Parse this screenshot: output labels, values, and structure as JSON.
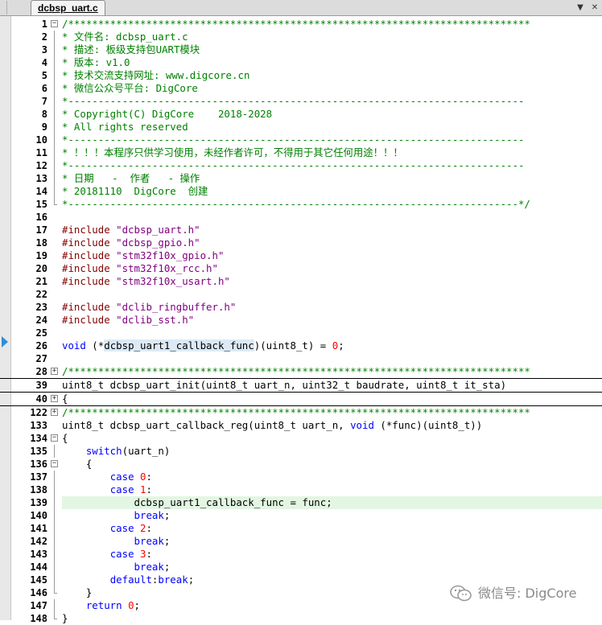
{
  "tab": {
    "title": "dcbsp_uart.c",
    "dropdown_icon": "chevron-down-icon",
    "close_icon": "close-icon"
  },
  "watermark": {
    "text": "微信号: DigCore",
    "icon": "wechat-icon"
  },
  "lines": [
    {
      "n": "1",
      "fold": "box-minus",
      "segs": [
        {
          "t": "/*****************************************************************************",
          "c": "comment"
        }
      ]
    },
    {
      "n": "2",
      "fold": "line",
      "segs": [
        {
          "t": "* 文件名: dcbsp_uart.c",
          "c": "comment"
        }
      ]
    },
    {
      "n": "3",
      "fold": "line",
      "segs": [
        {
          "t": "* 描述: 板级支持包UART模块",
          "c": "comment"
        }
      ]
    },
    {
      "n": "4",
      "fold": "line",
      "segs": [
        {
          "t": "* 版本: v1.0",
          "c": "comment"
        }
      ]
    },
    {
      "n": "5",
      "fold": "line",
      "segs": [
        {
          "t": "* 技术交流支持网址: www.digcore.cn",
          "c": "comment"
        }
      ]
    },
    {
      "n": "6",
      "fold": "line",
      "segs": [
        {
          "t": "* 微信公众号平台: DigCore",
          "c": "comment"
        }
      ]
    },
    {
      "n": "7",
      "fold": "line",
      "segs": [
        {
          "t": "*----------------------------------------------------------------------------",
          "c": "comment"
        }
      ]
    },
    {
      "n": "8",
      "fold": "line",
      "segs": [
        {
          "t": "* Copyright(C) DigCore    2018-2028",
          "c": "comment"
        }
      ]
    },
    {
      "n": "9",
      "fold": "line",
      "segs": [
        {
          "t": "* All rights reserved",
          "c": "comment"
        }
      ]
    },
    {
      "n": "10",
      "fold": "line",
      "segs": [
        {
          "t": "*----------------------------------------------------------------------------",
          "c": "comment"
        }
      ]
    },
    {
      "n": "11",
      "fold": "line",
      "segs": [
        {
          "t": "* ！！！本程序只供学习使用，未经作者许可，不得用于其它任何用途！！！",
          "c": "comment"
        }
      ]
    },
    {
      "n": "12",
      "fold": "line",
      "segs": [
        {
          "t": "*----------------------------------------------------------------------------",
          "c": "comment"
        }
      ]
    },
    {
      "n": "13",
      "fold": "line",
      "segs": [
        {
          "t": "* 日期   -  作者   - 操作",
          "c": "comment"
        }
      ]
    },
    {
      "n": "14",
      "fold": "line",
      "segs": [
        {
          "t": "* 20181110  DigCore  创建",
          "c": "comment"
        }
      ]
    },
    {
      "n": "15",
      "fold": "end",
      "segs": [
        {
          "t": "*---------------------------------------------------------------------------*/",
          "c": "comment"
        }
      ]
    },
    {
      "n": "16",
      "fold": "none",
      "segs": []
    },
    {
      "n": "17",
      "fold": "none",
      "segs": [
        {
          "t": "#include ",
          "c": "pp"
        },
        {
          "t": "\"dcbsp_uart.h\"",
          "c": "str"
        }
      ]
    },
    {
      "n": "18",
      "fold": "none",
      "segs": [
        {
          "t": "#include ",
          "c": "pp"
        },
        {
          "t": "\"dcbsp_gpio.h\"",
          "c": "str"
        }
      ]
    },
    {
      "n": "19",
      "fold": "none",
      "segs": [
        {
          "t": "#include ",
          "c": "pp"
        },
        {
          "t": "\"stm32f10x_gpio.h\"",
          "c": "str"
        }
      ]
    },
    {
      "n": "20",
      "fold": "none",
      "segs": [
        {
          "t": "#include ",
          "c": "pp"
        },
        {
          "t": "\"stm32f10x_rcc.h\"",
          "c": "str"
        }
      ]
    },
    {
      "n": "21",
      "fold": "none",
      "segs": [
        {
          "t": "#include ",
          "c": "pp"
        },
        {
          "t": "\"stm32f10x_usart.h\"",
          "c": "str"
        }
      ]
    },
    {
      "n": "22",
      "fold": "none",
      "segs": []
    },
    {
      "n": "23",
      "fold": "none",
      "segs": [
        {
          "t": "#include ",
          "c": "pp"
        },
        {
          "t": "\"dclib_ringbuffer.h\"",
          "c": "str"
        }
      ]
    },
    {
      "n": "24",
      "fold": "none",
      "segs": [
        {
          "t": "#include ",
          "c": "pp"
        },
        {
          "t": "\"dclib_sst.h\"",
          "c": "str"
        }
      ]
    },
    {
      "n": "25",
      "fold": "none",
      "segs": []
    },
    {
      "n": "26",
      "fold": "none",
      "segs": [
        {
          "t": "void",
          "c": "kw"
        },
        {
          "t": " (*",
          "c": "id"
        },
        {
          "t": "dcbsp_uart1_callback_func",
          "c": "idhl"
        },
        {
          "t": ")(uint8_t) = ",
          "c": "id"
        },
        {
          "t": "0",
          "c": "num"
        },
        {
          "t": ";",
          "c": "id"
        }
      ]
    },
    {
      "n": "27",
      "fold": "none",
      "segs": []
    },
    {
      "n": "28",
      "fold": "box-plus",
      "sep": true,
      "segs": [
        {
          "t": "/*****************************************************************************",
          "c": "comment"
        }
      ]
    },
    {
      "n": "39",
      "fold": "none",
      "sep": true,
      "segs": [
        {
          "t": "uint8_t dcbsp_uart_init(uint8_t uart_n, uint32_t baudrate, uint8_t it_sta)",
          "c": "id"
        }
      ]
    },
    {
      "n": "40",
      "fold": "box-plus",
      "sep": true,
      "segs": [
        {
          "t": "{",
          "c": "id"
        }
      ]
    },
    {
      "n": "122",
      "fold": "box-plus",
      "segs": [
        {
          "t": "/*****************************************************************************",
          "c": "comment"
        }
      ]
    },
    {
      "n": "133",
      "fold": "none",
      "segs": [
        {
          "t": "uint8_t dcbsp_uart_callback_reg(uint8_t uart_n, ",
          "c": "id"
        },
        {
          "t": "void",
          "c": "kw"
        },
        {
          "t": " (*func)(uint8_t))",
          "c": "id"
        }
      ]
    },
    {
      "n": "134",
      "fold": "box-minus",
      "segs": [
        {
          "t": "{",
          "c": "id"
        }
      ]
    },
    {
      "n": "135",
      "fold": "line",
      "segs": [
        {
          "t": "    ",
          "c": "id"
        },
        {
          "t": "switch",
          "c": "kw"
        },
        {
          "t": "(uart_n)",
          "c": "id"
        }
      ]
    },
    {
      "n": "136",
      "fold": "box-minus",
      "segs": [
        {
          "t": "    {",
          "c": "id"
        }
      ]
    },
    {
      "n": "137",
      "fold": "line",
      "segs": [
        {
          "t": "        ",
          "c": "id"
        },
        {
          "t": "case",
          "c": "kw"
        },
        {
          "t": " ",
          "c": "id"
        },
        {
          "t": "0",
          "c": "num"
        },
        {
          "t": ":",
          "c": "id"
        }
      ]
    },
    {
      "n": "138",
      "fold": "line",
      "segs": [
        {
          "t": "        ",
          "c": "id"
        },
        {
          "t": "case",
          "c": "kw"
        },
        {
          "t": " ",
          "c": "id"
        },
        {
          "t": "1",
          "c": "num"
        },
        {
          "t": ":",
          "c": "id"
        }
      ]
    },
    {
      "n": "139",
      "fold": "line",
      "hl": true,
      "segs": [
        {
          "t": "            dcbsp_uart1_callback_func = func;",
          "c": "id"
        }
      ]
    },
    {
      "n": "140",
      "fold": "line",
      "segs": [
        {
          "t": "            ",
          "c": "id"
        },
        {
          "t": "break",
          "c": "kw"
        },
        {
          "t": ";",
          "c": "id"
        }
      ]
    },
    {
      "n": "141",
      "fold": "line",
      "segs": [
        {
          "t": "        ",
          "c": "id"
        },
        {
          "t": "case",
          "c": "kw"
        },
        {
          "t": " ",
          "c": "id"
        },
        {
          "t": "2",
          "c": "num"
        },
        {
          "t": ":",
          "c": "id"
        }
      ]
    },
    {
      "n": "142",
      "fold": "line",
      "segs": [
        {
          "t": "            ",
          "c": "id"
        },
        {
          "t": "break",
          "c": "kw"
        },
        {
          "t": ";",
          "c": "id"
        }
      ]
    },
    {
      "n": "143",
      "fold": "line",
      "segs": [
        {
          "t": "        ",
          "c": "id"
        },
        {
          "t": "case",
          "c": "kw"
        },
        {
          "t": " ",
          "c": "id"
        },
        {
          "t": "3",
          "c": "num"
        },
        {
          "t": ":",
          "c": "id"
        }
      ]
    },
    {
      "n": "144",
      "fold": "line",
      "segs": [
        {
          "t": "            ",
          "c": "id"
        },
        {
          "t": "break",
          "c": "kw"
        },
        {
          "t": ";",
          "c": "id"
        }
      ]
    },
    {
      "n": "145",
      "fold": "line",
      "segs": [
        {
          "t": "        ",
          "c": "id"
        },
        {
          "t": "default",
          "c": "kw"
        },
        {
          "t": ":",
          "c": "id"
        },
        {
          "t": "break",
          "c": "kw"
        },
        {
          "t": ";",
          "c": "id"
        }
      ]
    },
    {
      "n": "146",
      "fold": "end",
      "segs": [
        {
          "t": "    }",
          "c": "id"
        }
      ]
    },
    {
      "n": "147",
      "fold": "line",
      "segs": [
        {
          "t": "    ",
          "c": "id"
        },
        {
          "t": "return",
          "c": "kw"
        },
        {
          "t": " ",
          "c": "id"
        },
        {
          "t": "0",
          "c": "num"
        },
        {
          "t": ";",
          "c": "id"
        }
      ]
    },
    {
      "n": "148",
      "fold": "end",
      "segs": [
        {
          "t": "}",
          "c": "id"
        }
      ]
    }
  ]
}
